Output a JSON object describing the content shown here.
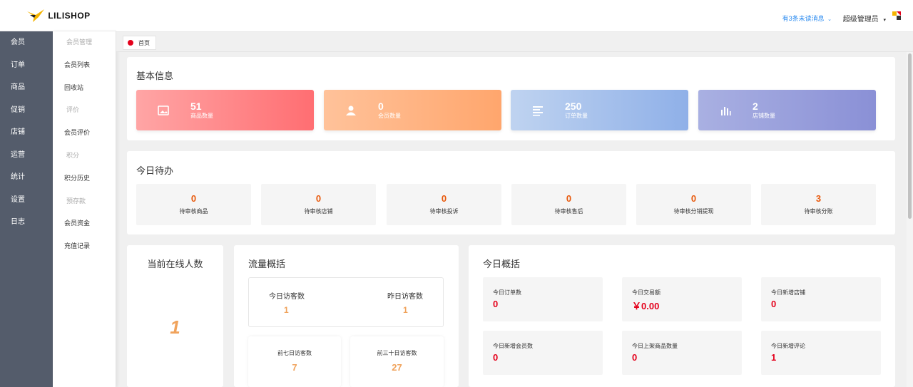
{
  "logo": {
    "text": "LILISHOP"
  },
  "rail": [
    "会员",
    "订单",
    "商品",
    "促销",
    "店铺",
    "运营",
    "统计",
    "设置",
    "日志"
  ],
  "submenu": [
    {
      "label": "会员管理",
      "group": true
    },
    {
      "label": "会员列表",
      "group": false
    },
    {
      "label": "回收站",
      "group": false
    },
    {
      "label": "评价",
      "group": true
    },
    {
      "label": "会员评价",
      "group": false
    },
    {
      "label": "积分",
      "group": true
    },
    {
      "label": "积分历史",
      "group": false
    },
    {
      "label": "预存款",
      "group": true
    },
    {
      "label": "会员资金",
      "group": false
    },
    {
      "label": "充值记录",
      "group": false
    }
  ],
  "header": {
    "messages": "有3条未读消息",
    "user": "超级管理员"
  },
  "tabs": [
    {
      "label": "首页"
    }
  ],
  "basic": {
    "title": "基本信息",
    "cards": [
      {
        "value": "51",
        "label": "商品数量",
        "icon": "image-icon",
        "from": "#ffa5a5",
        "to": "#ff6e72"
      },
      {
        "value": "0",
        "label": "会员数量",
        "icon": "user-icon",
        "from": "#ffc29a",
        "to": "#ffa66d"
      },
      {
        "value": "250",
        "label": "订单数量",
        "icon": "list-icon",
        "from": "#bfd3f0",
        "to": "#8fb0e8"
      },
      {
        "value": "2",
        "label": "店铺数量",
        "icon": "bar-chart-icon",
        "from": "#a9b0e2",
        "to": "#8a90d6"
      }
    ]
  },
  "todo": {
    "title": "今日待办",
    "items": [
      {
        "value": "0",
        "label": "待审核商品"
      },
      {
        "value": "0",
        "label": "待审核店铺"
      },
      {
        "value": "0",
        "label": "待审核投诉"
      },
      {
        "value": "0",
        "label": "待审核售后"
      },
      {
        "value": "0",
        "label": "待审核分销提现"
      },
      {
        "value": "3",
        "label": "待审核分账"
      }
    ]
  },
  "online": {
    "title": "当前在线人数",
    "value": "1"
  },
  "flow": {
    "title": "流量概括",
    "today": {
      "label": "今日访客数",
      "value": "1"
    },
    "yesterday": {
      "label": "昨日访客数",
      "value": "1"
    },
    "week": {
      "label": "前七日访客数",
      "value": "7"
    },
    "month": {
      "label": "前三十日访客数",
      "value": "27"
    }
  },
  "summary": {
    "title": "今日概括",
    "items": [
      {
        "label": "今日订单数",
        "value": "0"
      },
      {
        "label": "今日交易额",
        "value": "￥0.00"
      },
      {
        "label": "今日新增店铺",
        "value": "0"
      },
      {
        "label": "今日新增会员数",
        "value": "0"
      },
      {
        "label": "今日上架商品数量",
        "value": "0"
      },
      {
        "label": "今日新增评论",
        "value": "1"
      }
    ]
  }
}
